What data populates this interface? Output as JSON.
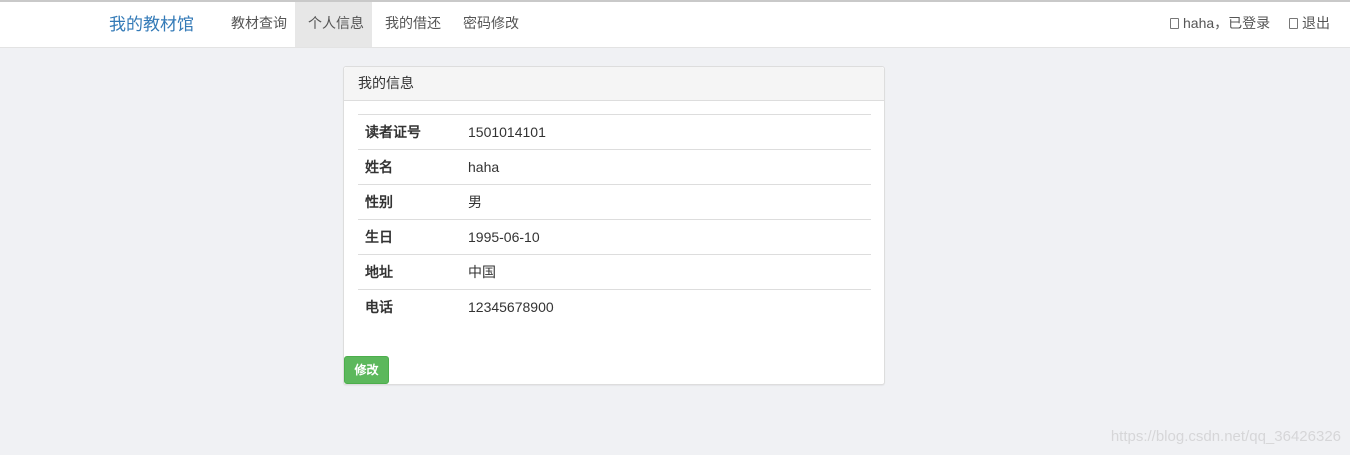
{
  "navbar": {
    "brand": "我的教材馆",
    "items": [
      {
        "label": "教材查询",
        "active": false
      },
      {
        "label": "个人信息",
        "active": true
      },
      {
        "label": "我的借还",
        "active": false
      },
      {
        "label": "密码修改",
        "active": false
      }
    ],
    "user_status": "haha，已登录",
    "logout_label": "退出"
  },
  "panel": {
    "title": "我的信息",
    "rows": [
      {
        "label": "读者证号",
        "value": "1501014101"
      },
      {
        "label": "姓名",
        "value": "haha"
      },
      {
        "label": "性别",
        "value": "男"
      },
      {
        "label": "生日",
        "value": "1995-06-10"
      },
      {
        "label": "地址",
        "value": "中国"
      },
      {
        "label": "电话",
        "value": "12345678900"
      }
    ],
    "edit_button": "修改"
  },
  "watermark": "https://blog.csdn.net/qq_36426326",
  "colors": {
    "brand": "#337ab7",
    "edit_button": "#5cb85c",
    "background": "#f0f1f4"
  }
}
